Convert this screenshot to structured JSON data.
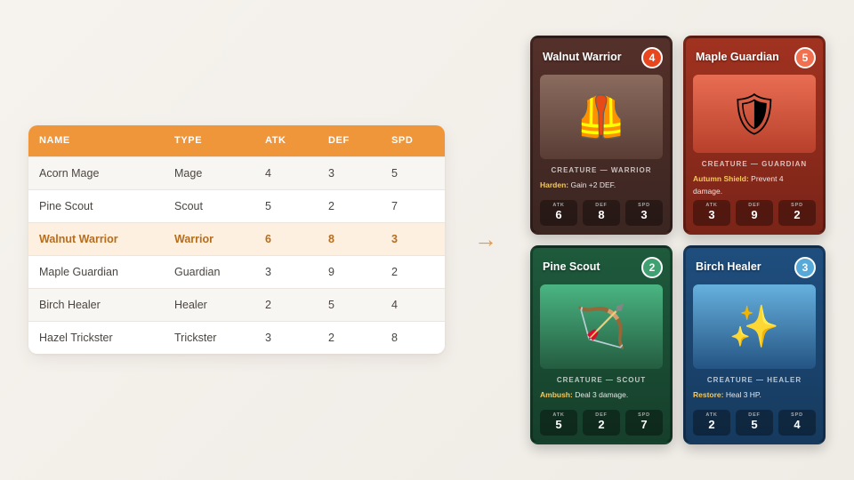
{
  "table": {
    "headers": [
      "NAME",
      "TYPE",
      "ATK",
      "DEF",
      "SPD"
    ],
    "rows": [
      [
        "Acorn Mage",
        "Mage",
        "4",
        "3",
        "5"
      ],
      [
        "Pine Scout",
        "Scout",
        "5",
        "2",
        "7"
      ],
      [
        "Walnut Warrior",
        "Warrior",
        "6",
        "8",
        "3"
      ],
      [
        "Maple Guardian",
        "Guardian",
        "3",
        "9",
        "2"
      ],
      [
        "Birch Healer",
        "Healer",
        "2",
        "5",
        "4"
      ],
      [
        "Hazel Trickster",
        "Trickster",
        "3",
        "2",
        "8"
      ]
    ],
    "highlighted_row": 2
  },
  "arrow": "→",
  "stat_labels": {
    "atk": "ATK",
    "def": "DEF",
    "spd": "SPD"
  },
  "cards": [
    {
      "name": "Walnut Warrior",
      "cost": "4",
      "art": "🦺",
      "type_line": "CREATURE — WARRIOR",
      "ability_name": "Harden:",
      "ability_text": " Gain +2 DEF.",
      "atk": "6",
      "def": "8",
      "spd": "3",
      "theme_color": "#55302a"
    },
    {
      "name": "Maple Guardian",
      "cost": "5",
      "art": "🛡",
      "type_line": "CREATURE — GUARDIAN",
      "ability_name": "Autumn Shield:",
      "ability_text": " Prevent 4 damage.",
      "atk": "3",
      "def": "9",
      "spd": "2",
      "theme_color": "#a13220"
    },
    {
      "name": "Pine Scout",
      "cost": "2",
      "art": "🏹",
      "type_line": "CREATURE — SCOUT",
      "ability_name": "Ambush:",
      "ability_text": " Deal 3 damage.",
      "atk": "5",
      "def": "2",
      "spd": "7",
      "theme_color": "#1e5a3c"
    },
    {
      "name": "Birch Healer",
      "cost": "3",
      "art": "✨",
      "type_line": "CREATURE — HEALER",
      "ability_name": "Restore:",
      "ability_text": " Heal 3 HP.",
      "atk": "2",
      "def": "5",
      "spd": "4",
      "theme_color": "#1f4e7e"
    }
  ],
  "colors": {
    "table_header": "#ee9639",
    "highlight_row_bg": "#fdf0e0",
    "highlight_row_text": "#b66d1d"
  }
}
